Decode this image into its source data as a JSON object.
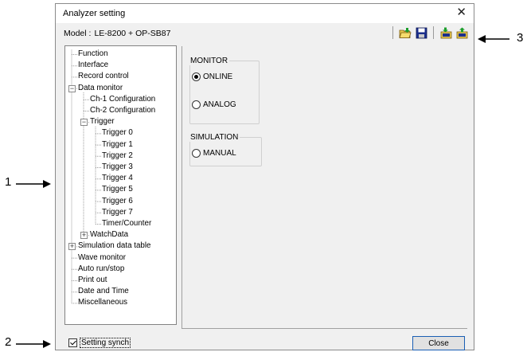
{
  "window": {
    "title": "Analyzer setting",
    "close_glyph": "✕",
    "model_label": "Model :",
    "model_value": "LE-8200 + OP-SB87"
  },
  "toolbar": {
    "icons": [
      "open-folder-icon",
      "save-disk-icon",
      "import-icon",
      "export-icon"
    ]
  },
  "tree": {
    "nodes": [
      {
        "label": "Function"
      },
      {
        "label": "Interface"
      },
      {
        "label": "Record control"
      },
      {
        "label": "Data monitor",
        "expander": "−"
      },
      {
        "label": "Ch-1 Configuration"
      },
      {
        "label": "Ch-2 Configuration"
      },
      {
        "label": "Trigger",
        "expander": "−"
      },
      {
        "label": "Trigger 0"
      },
      {
        "label": "Trigger 1"
      },
      {
        "label": "Trigger 2"
      },
      {
        "label": "Trigger 3"
      },
      {
        "label": "Trigger 4"
      },
      {
        "label": "Trigger 5"
      },
      {
        "label": "Trigger 6"
      },
      {
        "label": "Trigger 7"
      },
      {
        "label": "Timer/Counter"
      },
      {
        "label": "WatchData",
        "expander": "+"
      },
      {
        "label": "Simulation data table",
        "expander": "+"
      },
      {
        "label": "Wave monitor"
      },
      {
        "label": "Auto run/stop"
      },
      {
        "label": "Print out"
      },
      {
        "label": "Date and Time"
      },
      {
        "label": "Miscellaneous"
      }
    ]
  },
  "monitor": {
    "title": "MONITOR",
    "options": [
      {
        "label": "ONLINE",
        "selected": true
      },
      {
        "label": "ANALOG",
        "selected": false
      }
    ]
  },
  "simulation": {
    "title": "SIMULATION",
    "options": [
      {
        "label": "MANUAL",
        "selected": false
      }
    ]
  },
  "footer": {
    "setting_synch_label": "Setting synch",
    "setting_synch_checked": true,
    "close_button_label": "Close"
  },
  "callouts": {
    "one": "1",
    "two": "2",
    "three": "3"
  }
}
